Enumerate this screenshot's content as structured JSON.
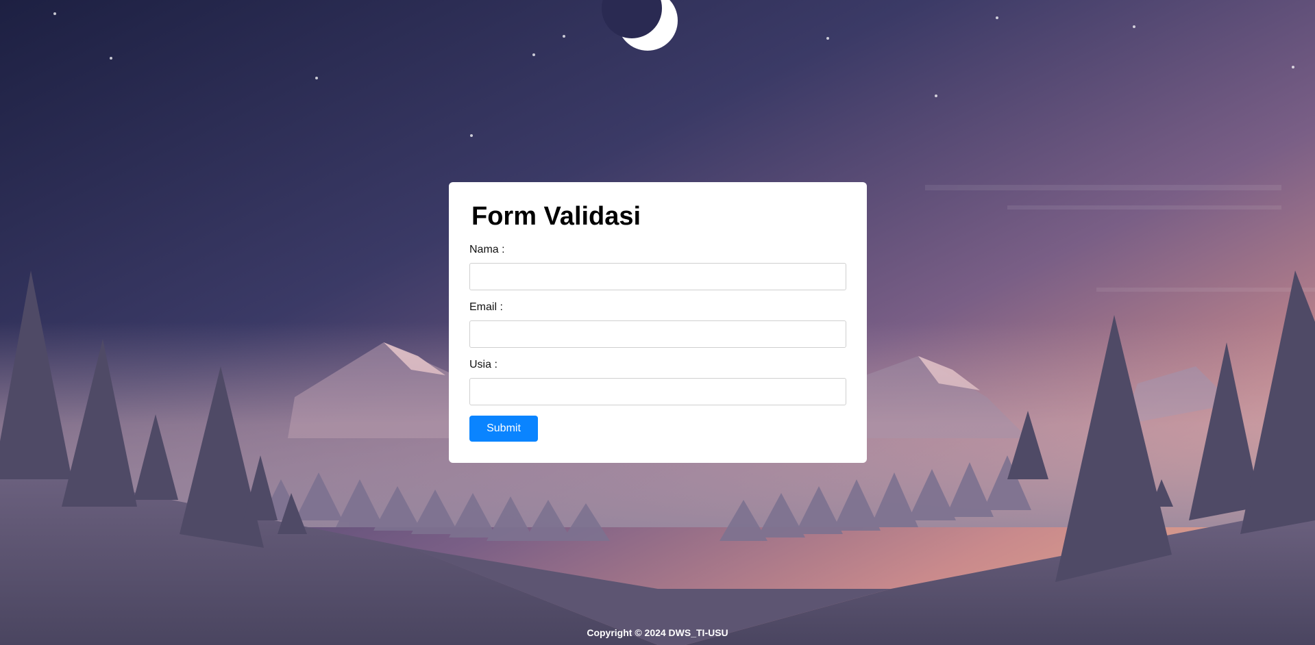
{
  "form": {
    "title": "Form Validasi",
    "fields": [
      {
        "label": "Nama :",
        "value": "",
        "placeholder": ""
      },
      {
        "label": "Email :",
        "value": "",
        "placeholder": ""
      },
      {
        "label": "Usia :",
        "value": "",
        "placeholder": ""
      }
    ],
    "submit_label": "Submit"
  },
  "footer": {
    "text": "Copyright © 2024 DWS_TI-USU"
  },
  "colors": {
    "accent": "#0a84ff",
    "sky_top": "#1f2244",
    "sky_horizon": "#e6a896",
    "card": "#ffffff"
  },
  "background": {
    "scene": "night-mountain-forest",
    "icons": [
      "moon-icon",
      "star-icon",
      "mountain-icon",
      "pine-tree-icon"
    ]
  }
}
